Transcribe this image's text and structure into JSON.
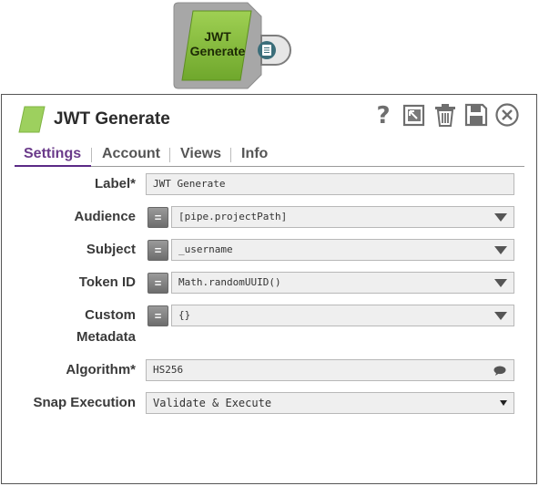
{
  "node": {
    "title_line1": "JWT",
    "title_line2": "Generate"
  },
  "dialog": {
    "title": "JWT Generate"
  },
  "toolbar": {
    "help": "help-icon",
    "export": "export-icon",
    "delete": "trash-icon",
    "save": "save-icon",
    "close": "close-icon"
  },
  "tabs": [
    {
      "label": "Settings",
      "active": true
    },
    {
      "label": "Account"
    },
    {
      "label": "Views"
    },
    {
      "label": "Info"
    }
  ],
  "fields": {
    "label": {
      "label": "Label*",
      "value": "JWT Generate"
    },
    "audience": {
      "label": "Audience",
      "value": "[pipe.projectPath]"
    },
    "subject": {
      "label": "Subject",
      "value": "_username"
    },
    "token_id": {
      "label": "Token ID",
      "value": "Math.randomUUID()"
    },
    "custom_metadata": {
      "label_line1": "Custom",
      "label_line2": "Metadata",
      "value": "{}"
    },
    "algorithm": {
      "label": "Algorithm*",
      "value": "HS256"
    },
    "snap_execution": {
      "label": "Snap Execution",
      "value": "Validate & Execute"
    }
  },
  "expression_toggle": "=",
  "colors": {
    "accent": "#5b2a86",
    "node_green": "#8dc33f"
  }
}
